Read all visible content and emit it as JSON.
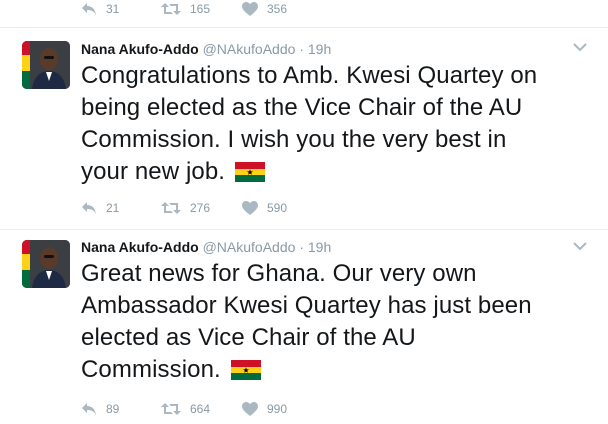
{
  "top_actions": {
    "replies": "31",
    "retweets": "165",
    "likes": "356"
  },
  "tweets": [
    {
      "name": "Nana Akufo-Addo",
      "handle": "@NAkufoAddo",
      "separator": "·",
      "time": "19h",
      "text_lines": [
        "Congratulations to Amb. Kwesi Quartey on",
        "being elected as the Vice Chair of the AU",
        "Commission. I wish you the very best in",
        "your new job."
      ],
      "emoji": "ghana-flag",
      "replies": "21",
      "retweets": "276",
      "likes": "590"
    },
    {
      "name": "Nana Akufo-Addo",
      "handle": "@NAkufoAddo",
      "separator": "·",
      "time": "19h",
      "text_lines": [
        "Great news for Ghana. Our very own",
        "Ambassador Kwesi Quartey has just been",
        "elected as Vice Chair of the AU",
        "Commission."
      ],
      "emoji": "ghana-flag",
      "replies": "89",
      "retweets": "664",
      "likes": "990"
    }
  ],
  "colors": {
    "icon": "#aab8c2",
    "count": "#8899a6",
    "divider": "#e6ecf0",
    "flag_red": "#ce1126",
    "flag_gold": "#fcd116",
    "flag_green": "#006b3f"
  }
}
